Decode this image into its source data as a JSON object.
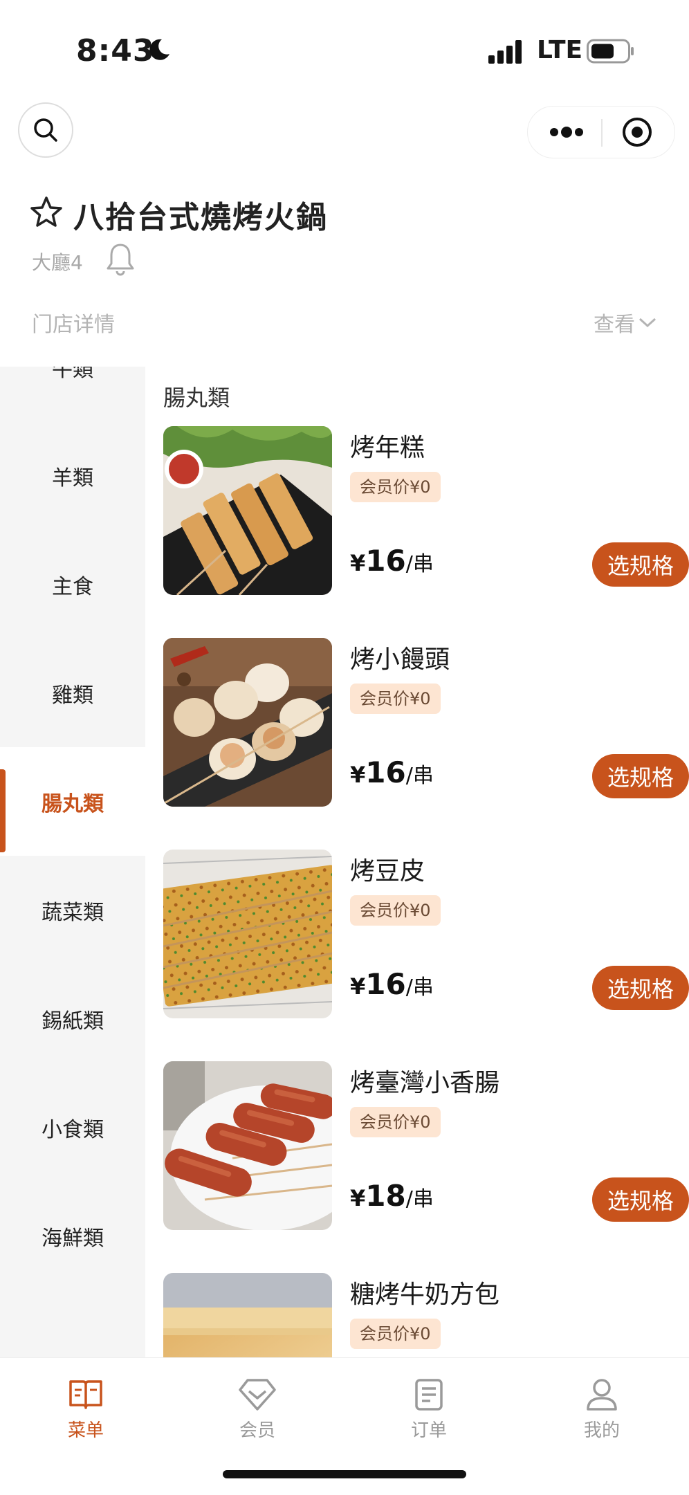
{
  "status_bar": {
    "time": "8:43",
    "network": "LTE"
  },
  "store": {
    "name": "八拾台式燒烤火鍋",
    "table": "大廳4",
    "detail_label": "门店详情",
    "view_label": "查看"
  },
  "categories": [
    {
      "label": "牛類"
    },
    {
      "label": "羊類"
    },
    {
      "label": "主食"
    },
    {
      "label": "雞類"
    },
    {
      "label": "腸丸類",
      "active": true
    },
    {
      "label": "蔬菜類"
    },
    {
      "label": "錫紙類"
    },
    {
      "label": "小食類"
    },
    {
      "label": "海鮮類"
    }
  ],
  "section_title": "腸丸類",
  "items": [
    {
      "name": "烤年糕",
      "member_price": "会员价¥0",
      "currency": "¥",
      "price": "16",
      "unit": "/串",
      "button": "选规格"
    },
    {
      "name": "烤小饅頭",
      "member_price": "会员价¥0",
      "currency": "¥",
      "price": "16",
      "unit": "/串",
      "button": "选规格"
    },
    {
      "name": "烤豆皮",
      "member_price": "会员价¥0",
      "currency": "¥",
      "price": "16",
      "unit": "/串",
      "button": "选规格"
    },
    {
      "name": "烤臺灣小香腸",
      "member_price": "会员价¥0",
      "currency": "¥",
      "price": "18",
      "unit": "/串",
      "button": "选规格"
    },
    {
      "name": "糖烤牛奶方包",
      "member_price": "会员价¥0",
      "currency": "¥",
      "price": "",
      "unit": "",
      "button": ""
    }
  ],
  "tabs": [
    {
      "label": "菜单",
      "icon": "menu-book-icon",
      "active": true
    },
    {
      "label": "会员",
      "icon": "diamond-icon"
    },
    {
      "label": "订单",
      "icon": "order-list-icon"
    },
    {
      "label": "我的",
      "icon": "user-icon"
    }
  ],
  "colors": {
    "accent": "#c8531c",
    "badge_bg": "#fde5d2",
    "sidebar_bg": "#f5f5f5"
  }
}
